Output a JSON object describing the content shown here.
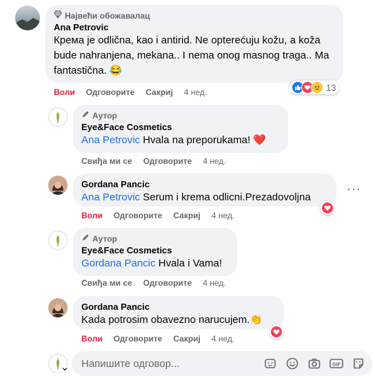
{
  "comments": [
    {
      "badge": "Највећи обожавалац",
      "author": "Ana Petrovic",
      "text": "Крема је odlična, kao i antirid. Ne opterećuju kožu, a koža bude nahranjena, mekana.. I nema onog masnog traga.. Ma fantastična. 😂",
      "actions": {
        "like": "Воли",
        "reply": "Одговорите",
        "share": "Сакриј",
        "time": "4 нед."
      },
      "reactions_count": "13"
    },
    {
      "badge": "Аутор",
      "author": "Eye&Face Cosmetics",
      "mention": "Ana Petrovic",
      "text": "Hvala na preporukama! ❤️",
      "actions": {
        "like": "Свиђа ми се",
        "reply": "Одговорите",
        "time": "4 нед."
      }
    },
    {
      "author": "Gordana Pancic",
      "mention": "Ana Petrovic",
      "text": "Serum i krema odlicni.Prezadovoljna",
      "actions": {
        "like": "Воли",
        "reply": "Одговорите",
        "share": "Сакриј",
        "time": "4 нед."
      }
    },
    {
      "badge": "Аутор",
      "author": "Eye&Face Cosmetics",
      "mention": "Gordana Pancic",
      "text": "Hvala i Vama!",
      "actions": {
        "like": "Свиђа ми се",
        "reply": "Одговорите",
        "time": "4 нед."
      }
    },
    {
      "author": "Gordana Pancic",
      "text": "Kada potrosim obavezno narucujem.👏",
      "actions": {
        "like": "Воли",
        "reply": "Одговорите",
        "share": "Сакриј",
        "time": "4 нед."
      }
    }
  ],
  "reply_box": {
    "placeholder": "Напишите одговор..."
  },
  "colors": {
    "mention": "#216fdb",
    "liked": "#e41e3f",
    "bubble": "#f0f2f5",
    "muted": "#65676b"
  },
  "icons": [
    "diamond-icon",
    "pencil-icon",
    "like-reaction-icon",
    "love-reaction-icon",
    "sad-reaction-icon",
    "more-options-icon",
    "sticker-icon",
    "emoji-icon",
    "camera-icon",
    "gif-icon",
    "sticker-face-icon"
  ]
}
